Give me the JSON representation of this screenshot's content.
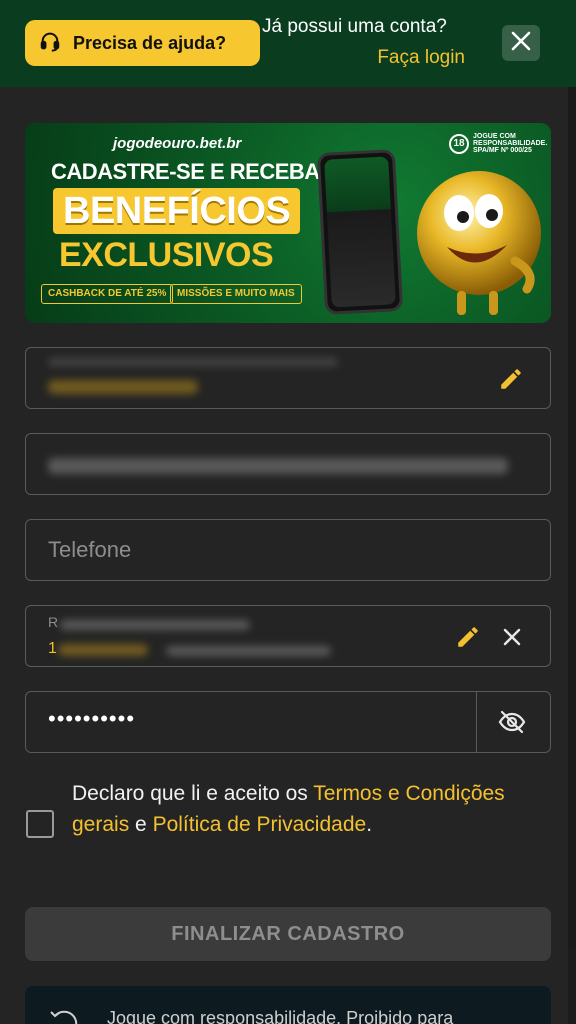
{
  "header": {
    "help_label": "Precisa de ajuda?",
    "account_question": "Já possui uma conta?",
    "login_label": "Faça login",
    "help_icon": "headset-icon",
    "close_icon": "close-icon"
  },
  "banner": {
    "brand": "jogodeouro.bet.br",
    "age": "18",
    "age_note": "JOGUE COM RESPONSABILIDADE. SPA/MF Nº 000/25",
    "line1": "CADASTRE-SE E RECEBA",
    "line2": "BENEFÍCIOS",
    "line3": "EXCLUSIVOS",
    "pill1": "CASHBACK DE ATÉ 25%",
    "pill2": "MISSÕES E MUITO MAIS"
  },
  "form": {
    "phone_placeholder": "Telefone",
    "address_label": "R",
    "address_value": "1",
    "password_mask": "••••••••••",
    "edit_icon": "pencil-icon",
    "toggle_icon": "eye-off-icon",
    "terms": {
      "prefix": "Declaro que li e aceito os ",
      "terms_link": "Termos e Condições gerais",
      "middle": " e ",
      "privacy_link": "Política de Privacidade",
      "suffix": "."
    },
    "submit_label": "FINALIZAR CADASTRO"
  },
  "footer": {
    "responsible_text": "Jogue com responsabilidade. Proibido para"
  },
  "colors": {
    "topbar": "#0a3d1f",
    "accent": "#f7c72f",
    "panel": "#242424"
  }
}
